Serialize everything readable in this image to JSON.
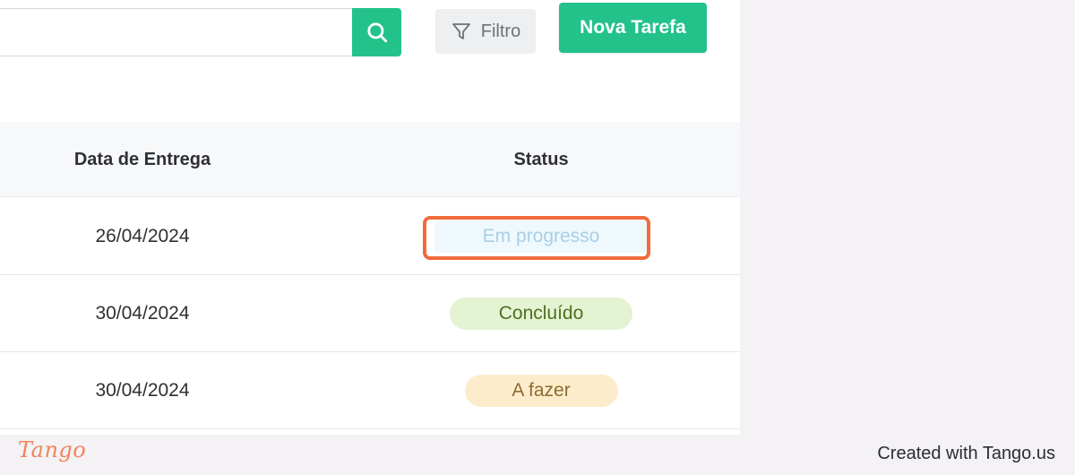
{
  "toolbar": {
    "search_placeholder": "",
    "search_value": "",
    "filter_label": "Filtro",
    "new_task_label": "Nova Tarefa"
  },
  "table": {
    "columns": [
      "Data de Entrega",
      "Status"
    ],
    "rows": [
      {
        "due_date": "26/04/2024",
        "status": "Em progresso"
      },
      {
        "due_date": "30/04/2024",
        "status": "Concluído"
      },
      {
        "due_date": "30/04/2024",
        "status": "A fazer"
      }
    ]
  },
  "footer": {
    "logo": "Tango",
    "credit": "Created with Tango.us"
  },
  "colors": {
    "accent_green": "#23c28b",
    "highlight_orange": "#f06b3b",
    "status_progress_bg": "#eef8fd",
    "status_done_bg": "#e4f3d2",
    "status_todo_bg": "#fdeccb"
  },
  "icons": {
    "search": "search-icon",
    "filter": "filter-icon"
  }
}
